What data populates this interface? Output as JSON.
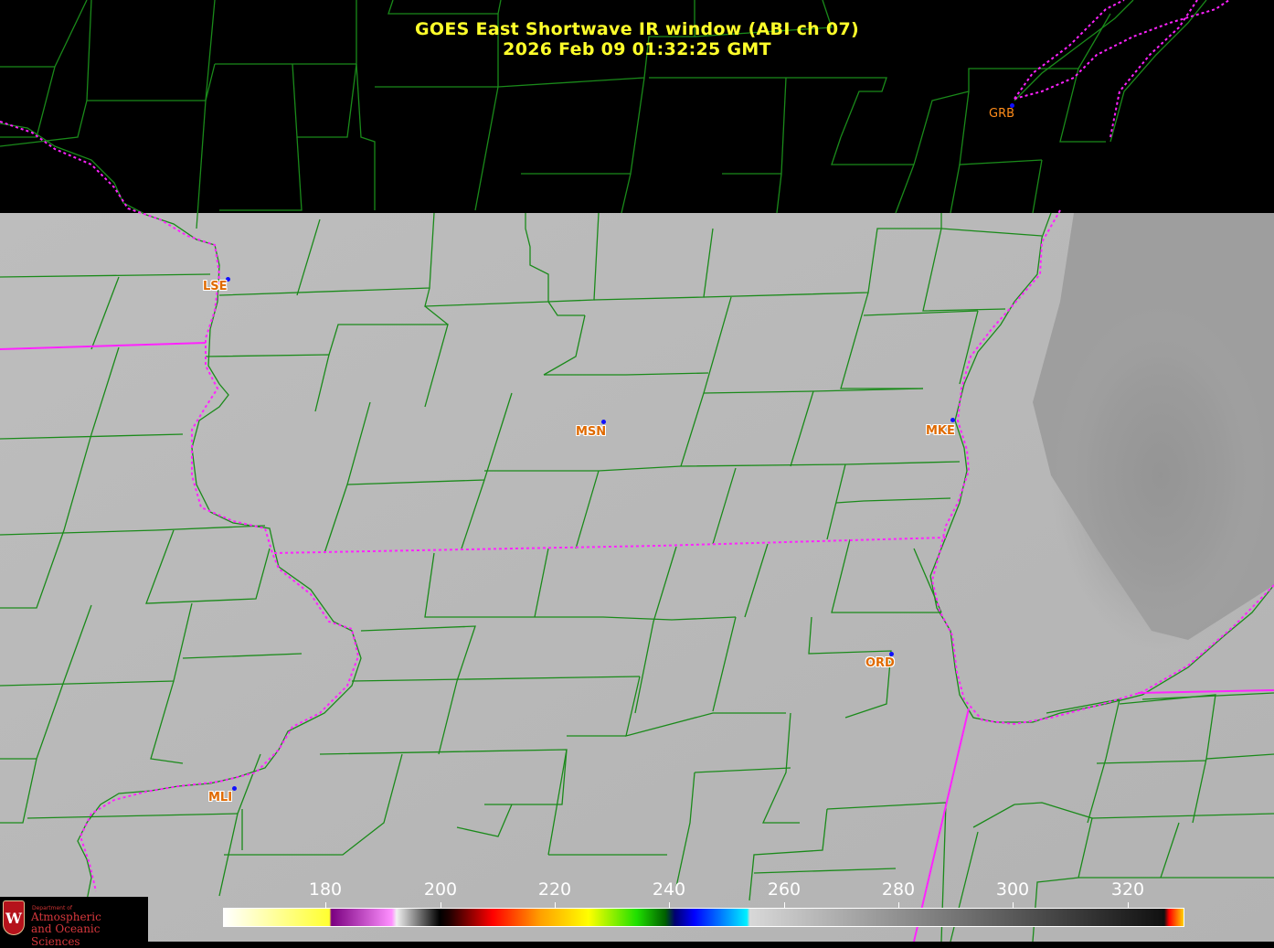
{
  "header": {
    "title_line1": "GOES East Shortwave IR window (ABI ch 07)",
    "title_line2": "2026 Feb 09  01:32:25 GMT"
  },
  "stations": [
    {
      "id": "GRB",
      "style": "plain"
    },
    {
      "id": "LSE",
      "style": "halo"
    },
    {
      "id": "MSN",
      "style": "halo"
    },
    {
      "id": "MKE",
      "style": "halo"
    },
    {
      "id": "ORD",
      "style": "halo"
    },
    {
      "id": "MLI",
      "style": "halo"
    }
  ],
  "colorbar": {
    "ticks": [
      "180",
      "200",
      "220",
      "240",
      "260",
      "280",
      "300",
      "320"
    ],
    "tick_values": [
      180,
      200,
      220,
      240,
      260,
      280,
      300,
      320
    ],
    "range": [
      164,
      332
    ]
  },
  "colors": {
    "title": "#ffff2a",
    "county_lines": "#1a8a1a",
    "state_lines": "#ff22ff",
    "land_gray": "#b7b7b7",
    "no_data": "#000000",
    "station_dot": "#1010ff",
    "station_label": "#ff8c1a"
  },
  "logo": {
    "seal_letter": "W",
    "dept_small": "Department of",
    "line1": "Atmospheric",
    "line2": "and Oceanic Sciences"
  }
}
